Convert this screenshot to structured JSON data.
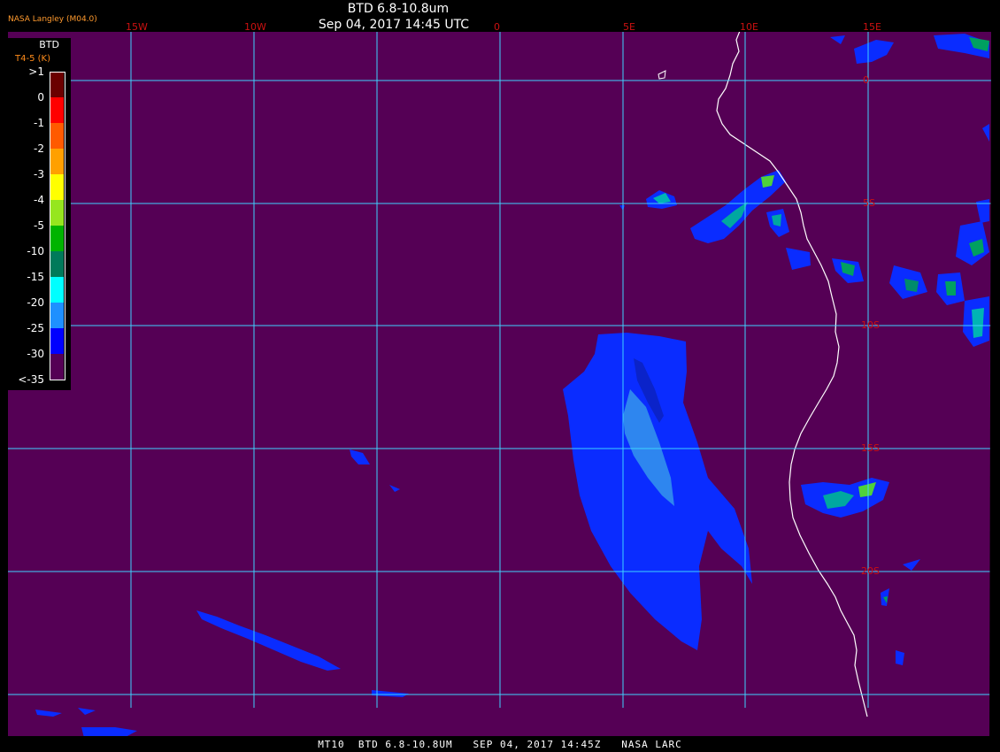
{
  "header": {
    "title": "BTD 6.8-10.8um",
    "datetime": "Sep 04, 2017 14:45 UTC"
  },
  "credit": "NASA Langley (M04.0)",
  "footer": "MT10  BTD 6.8-10.8UM   SEP 04, 2017 14:45Z   NASA LARC",
  "legend": {
    "title": "BTD",
    "subtitle": "T4-5 (K)",
    "entries": [
      {
        "label": ">1",
        "color": "#6b0000"
      },
      {
        "label": "0",
        "color": "#ff0000"
      },
      {
        "label": "-1",
        "color": "#ff5a00"
      },
      {
        "label": "-2",
        "color": "#ffa000"
      },
      {
        "label": "-3",
        "color": "#ffff00"
      },
      {
        "label": "-4",
        "color": "#96e61e"
      },
      {
        "label": "-5",
        "color": "#00b400"
      },
      {
        "label": "-10",
        "color": "#007a5a"
      },
      {
        "label": "-15",
        "color": "#00ffff"
      },
      {
        "label": "-20",
        "color": "#1e90ff"
      },
      {
        "label": "-25",
        "color": "#0000ff"
      },
      {
        "label": "-30",
        "color": "#550055"
      },
      {
        "label": "<-35",
        "color": "#550055"
      }
    ]
  },
  "grid": {
    "longitude_labels": [
      "15W",
      "10W",
      "0",
      "5E",
      "10E",
      "15E"
    ],
    "latitude_labels": [
      "0",
      "5S",
      "10S",
      "15S",
      "20S"
    ]
  },
  "colors": {
    "background": "#550055",
    "grid": "#3fd2ff",
    "grid_label": "#cc1111",
    "coastline": "#ffffff"
  }
}
